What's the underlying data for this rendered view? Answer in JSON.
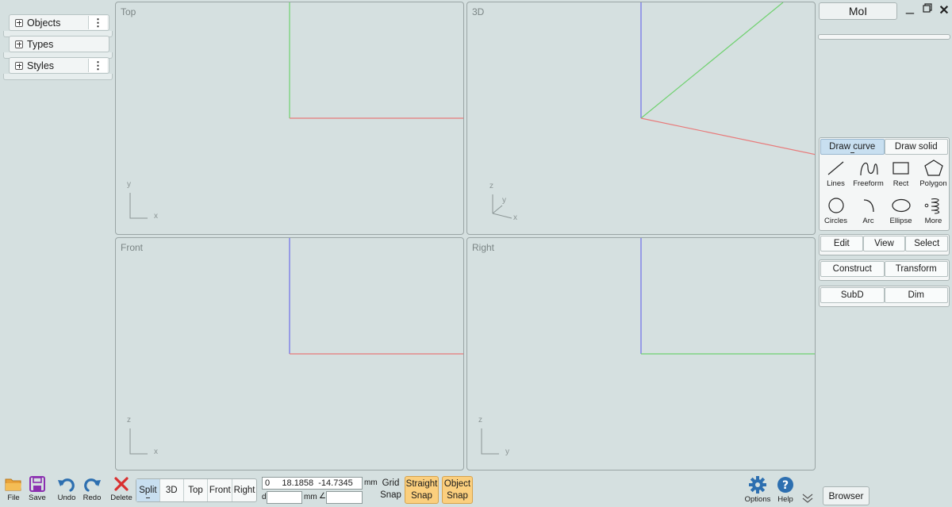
{
  "browser_panel": {
    "items": [
      {
        "label": "Objects",
        "menu": "⋮"
      },
      {
        "label": "Types",
        "menu": ""
      },
      {
        "label": "Styles",
        "menu": "⋮"
      }
    ]
  },
  "viewports": {
    "top": {
      "title": "Top",
      "axis_h": "x",
      "axis_v": "y"
    },
    "3d": {
      "title": "3D",
      "axis_x": "x",
      "axis_y": "y",
      "axis_z": "z"
    },
    "front": {
      "title": "Front",
      "axis_h": "x",
      "axis_v": "z"
    },
    "right": {
      "title": "Right",
      "axis_h": "y",
      "axis_v": "z"
    }
  },
  "window": {
    "app_button": "MoI",
    "minimize_icon": "minimize-icon",
    "restore_icon": "restore-icon",
    "close_icon": "close-icon"
  },
  "draw_panel": {
    "tabs": [
      "Draw curve",
      "Draw solid"
    ],
    "active_tab": "Draw curve",
    "tools": [
      {
        "label": "Lines",
        "icon": "line-icon"
      },
      {
        "label": "Freeform",
        "icon": "freeform-icon"
      },
      {
        "label": "Rect",
        "icon": "rectangle-icon"
      },
      {
        "label": "Polygon",
        "icon": "polygon-icon"
      },
      {
        "label": "Circles",
        "icon": "circle-icon"
      },
      {
        "label": "Arc",
        "icon": "arc-icon"
      },
      {
        "label": "Ellipse",
        "icon": "ellipse-icon"
      },
      {
        "label": "More",
        "icon": "helix-icon"
      }
    ]
  },
  "command_groups": [
    [
      "Edit",
      "View",
      "Select"
    ],
    [
      "Construct",
      "Transform"
    ],
    [
      "SubD",
      "Dim"
    ]
  ],
  "bottom_toolbar": {
    "file": "File",
    "save": "Save",
    "undo": "Undo",
    "redo": "Redo",
    "delete": "Delete",
    "view_modes": [
      "Split",
      "3D",
      "Top",
      "Front",
      "Right"
    ],
    "active_view_mode": "Split",
    "coordinates": "0     18.1858  -14.7345",
    "coord_unit": "mm",
    "distance_label": "d",
    "distance_unit": "mm",
    "angle_label": "∠",
    "grid_snap": [
      "Grid",
      "Snap"
    ],
    "straight_snap": [
      "Straight",
      "Snap"
    ],
    "object_snap": [
      "Object",
      "Snap"
    ],
    "options": "Options",
    "help": "Help",
    "browser": "Browser"
  },
  "colors": {
    "x_axis": "#e87a7a",
    "y_axis": "#6fd16f",
    "z_axis": "#6e6ee8",
    "accent_tab": "#c8dff0",
    "snap_active": "#fbcf7e",
    "icon_blue": "#2d6fb0",
    "delete_red": "#d93030"
  }
}
